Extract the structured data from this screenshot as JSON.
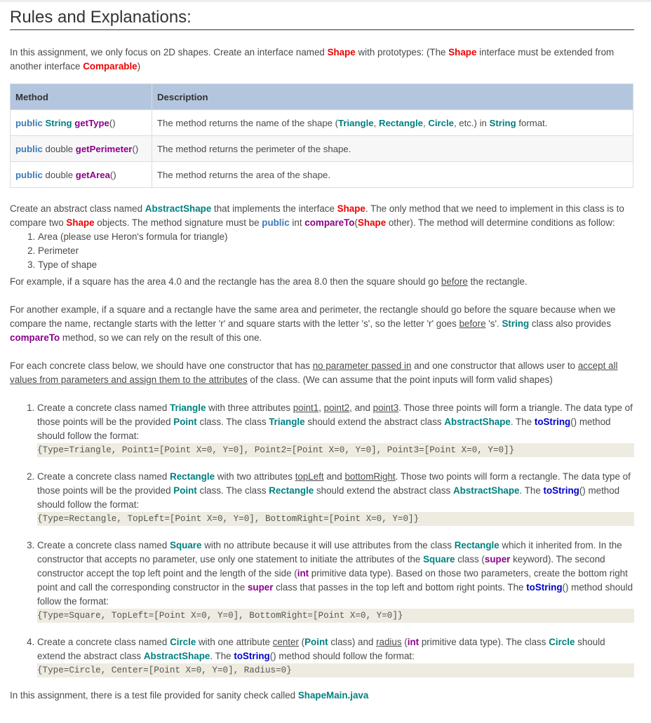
{
  "heading": "Rules and Explanations:",
  "intro": {
    "t1": "In this assignment, we only focus on 2D shapes. Create an interface named ",
    "shape": "Shape",
    "t2": " with prototypes: (The ",
    "t3": " interface must be extended from another interface ",
    "comparable": "Comparable",
    "t4": ")"
  },
  "table": {
    "headers": [
      "Method",
      "Description"
    ],
    "rows": [
      {
        "public": "public",
        "type": "String",
        "name": "getType",
        "parens": "()",
        "desc_pre": "The method returns the name of the shape (",
        "triangle": "Triangle",
        "rectangle": "Rectangle",
        "circle": "Circle",
        "desc_mid": ", etc.) in ",
        "string": "String",
        "desc_post": " format."
      },
      {
        "public": "public",
        "type": "double",
        "name": "getPerimeter",
        "parens": "()",
        "desc": "The method returns the perimeter of the shape."
      },
      {
        "public": "public",
        "type": "double",
        "name": "getArea",
        "parens": "()",
        "desc": "The method returns the area of the shape."
      }
    ]
  },
  "abstract": {
    "t1": "Create an abstract class named ",
    "abstractShape": "AbstractShape",
    "t2": " that implements the interface ",
    "shape": "Shape",
    "t3": ". The only method that we need to implement in this class is to compare two ",
    "t4": " objects. The method signature must be ",
    "public": "public",
    "t5": " int ",
    "compareTo": "compareTo",
    "t6": "(",
    "t7": " other). The method will determine conditions as follow:",
    "conditions": [
      "Area (please use Heron's formula for triangle)",
      "Perimeter",
      "Type of shape"
    ]
  },
  "example1": {
    "t1": "For example, if a square has the area 4.0 and the rectangle has the area 8.0 then the square should go ",
    "before": "before",
    "t2": " the rectangle."
  },
  "example2": {
    "t1": "For another example, if a square and a rectangle have the same area and perimeter, the rectangle should go before the square because when we compare the name, rectangle starts with the letter 'r' and square starts with the letter 's', so the letter 'r' goes ",
    "before": "before",
    "t2": " 's'. ",
    "string": "String",
    "t3": " class also provides ",
    "compareTo": "compareTo",
    "t4": " method, so we can rely on the result of this one."
  },
  "concrete": {
    "t1": "For each concrete class below, we should have one constructor that has ",
    "noParam": "no parameter passed in",
    "t2": " and one constructor that allows user to ",
    "accept": "accept all values from parameters and assign them to the attributes",
    "t3": " of the class. (We can assume that the point inputs will form valid shapes)"
  },
  "classes": {
    "triangle": {
      "t1": "Create a concrete class named ",
      "name": "Triangle",
      "t2": " with three attributes ",
      "p1": "point1",
      "c1": ", ",
      "p2": "point2",
      "c2": ", and ",
      "p3": "point3",
      "t3": ". Those three points will form a triangle. The data type of those points will be the provided ",
      "point": "Point",
      "t4": " class. The class ",
      "t5": " should extend the abstract class ",
      "abstractShape": "AbstractShape",
      "t6": ". The ",
      "toString": "toString",
      "t7": "() method should follow the format:",
      "code": "{Type=Triangle, Point1=[Point X=0, Y=0], Point2=[Point X=0, Y=0], Point3=[Point X=0, Y=0]}"
    },
    "rectangle": {
      "t1": "Create a concrete class named ",
      "name": "Rectangle",
      "t2": " with two attributes ",
      "a1": "topLeft",
      "c1": " and ",
      "a2": "bottomRight",
      "t3": ". Those two points will form a rectangle. The data type of those points will be the provided ",
      "point": "Point",
      "t4": " class. The class ",
      "t5": " should extend the abstract class ",
      "abstractShape": "AbstractShape",
      "t6": ". The ",
      "toString": "toString",
      "t7": "() method should follow the format:",
      "code": "{Type=Rectangle, TopLeft=[Point X=0, Y=0], BottomRight=[Point X=0, Y=0]}"
    },
    "square": {
      "t1": "Create a concrete class named ",
      "name": "Square",
      "t2": " with no attribute because it will use attributes from the class ",
      "rectangle": "Rectangle",
      "t3": " which it inherited from. In the constructor that accepts no parameter, use only one statement to initiate the attributes of the ",
      "t4": " class (",
      "super": "super",
      "t5": " keyword). The second constructor accept the top left point and the length of the side (",
      "int": "int",
      "t6": " primitive data type). Based on those two parameters, create the bottom right point and call the corresponding constructor in the ",
      "t7": " class that passes in the top left and bottom right points. The ",
      "toString": "toString",
      "t8": "() method should follow the format:",
      "code": "{Type=Square, TopLeft=[Point X=0, Y=0], BottomRight=[Point X=0, Y=0]}"
    },
    "circle": {
      "t1": "Create a concrete class named ",
      "name": "Circle",
      "t2": " with one attribute ",
      "center": "center",
      "t3": " (",
      "point": "Point",
      "t4": " class) and ",
      "radius": "radius",
      "t5": " (",
      "int": "int",
      "t6": " primitive data type). The class ",
      "t7": " should extend the abstract class ",
      "abstractShape": "AbstractShape",
      "t8": ". The ",
      "toString": "toString",
      "t9": "() method should follow the format:",
      "code": "{Type=Circle, Center=[Point X=0, Y=0], Radius=0}"
    }
  },
  "footer": {
    "t1": "In this assignment, there is a test file provided for sanity check called ",
    "file": "ShapeMain.java"
  }
}
